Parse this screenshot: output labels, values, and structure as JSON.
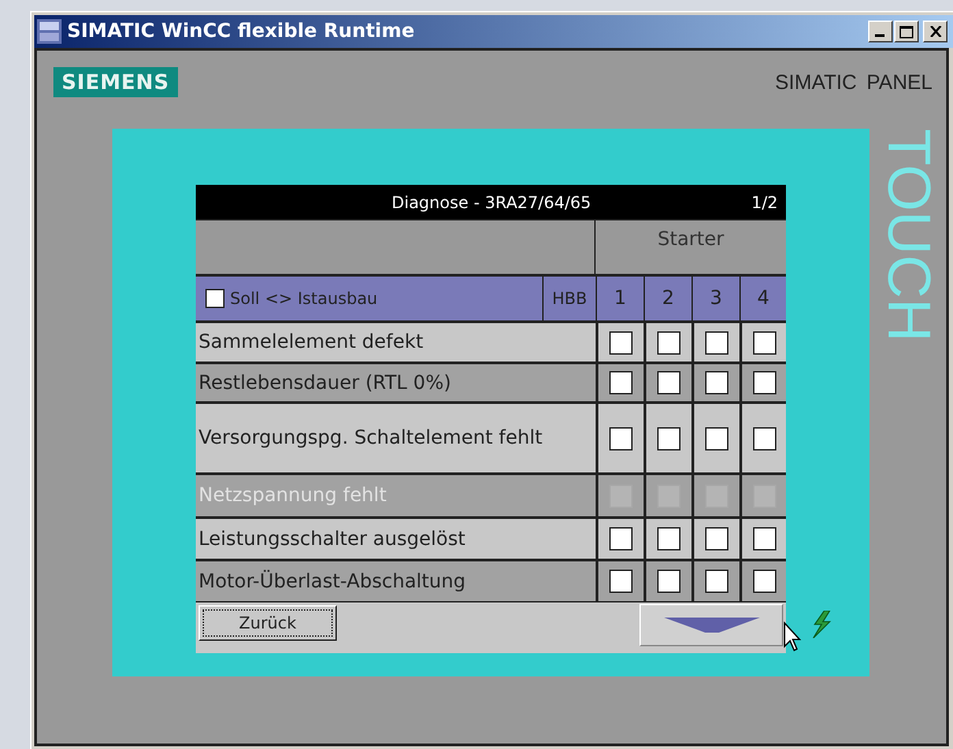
{
  "window": {
    "title": "SIMATIC WinCC flexible Runtime"
  },
  "brand": {
    "logo": "SIEMENS",
    "panel_label": "SIMATIC PANEL",
    "touch_label": "TOUCH"
  },
  "table": {
    "title": "Diagnose - 3RA27/64/65",
    "page": "1/2",
    "group_header": "Starter",
    "select_all": {
      "label": "Soll <> Istausbau",
      "checked": false
    },
    "hbb": "HBB",
    "columns": [
      "1",
      "2",
      "3",
      "4"
    ],
    "rows": [
      {
        "label": "Sammelelement defekt",
        "disabled": false,
        "cells": [
          {
            "checked": false
          },
          {
            "checked": false
          },
          {
            "checked": false
          },
          {
            "checked": false
          }
        ]
      },
      {
        "label": "Restlebensdauer (RTL 0%)",
        "disabled": false,
        "cells": [
          {
            "checked": false
          },
          {
            "checked": false
          },
          {
            "checked": false
          },
          {
            "checked": false
          }
        ]
      },
      {
        "label": "Versorgungspg. Schaltelement fehlt",
        "disabled": false,
        "cells": [
          {
            "checked": false
          },
          {
            "checked": false
          },
          {
            "checked": false
          },
          {
            "checked": false
          }
        ]
      },
      {
        "label": "Netzspannung fehlt",
        "disabled": true,
        "cells": [
          {
            "checked": false
          },
          {
            "checked": false
          },
          {
            "checked": false
          },
          {
            "checked": false
          }
        ]
      },
      {
        "label": "Leistungsschalter ausgelöst",
        "disabled": false,
        "cells": [
          {
            "checked": false
          },
          {
            "checked": false
          },
          {
            "checked": false
          },
          {
            "checked": false
          }
        ]
      },
      {
        "label": "Motor-Überlast-Abschaltung",
        "disabled": false,
        "cells": [
          {
            "checked": false
          },
          {
            "checked": false
          },
          {
            "checked": false
          },
          {
            "checked": false
          }
        ]
      }
    ]
  },
  "buttons": {
    "back": "Zurück"
  }
}
